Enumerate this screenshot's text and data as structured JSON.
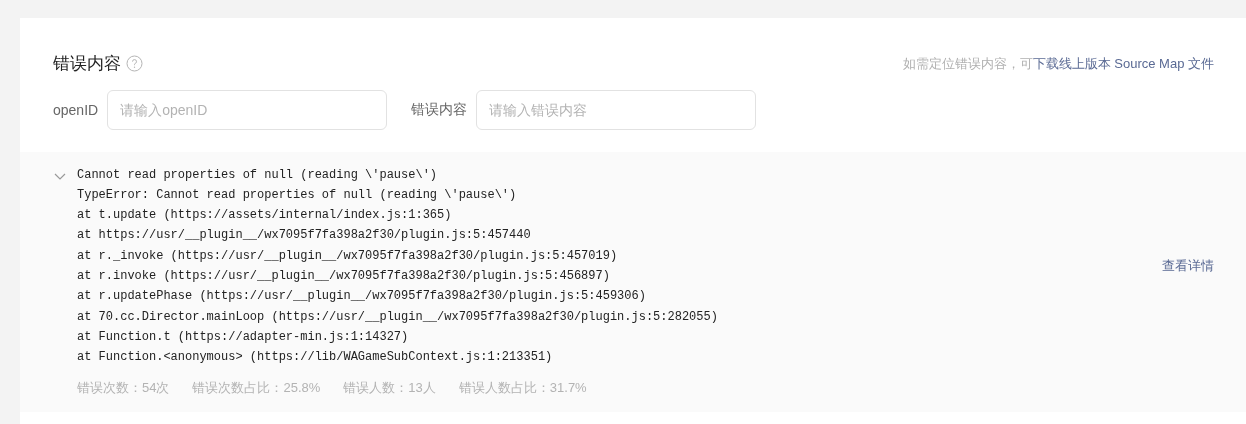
{
  "section": {
    "title": "错误内容",
    "hint_prefix": "如需定位错误内容，可",
    "hint_link": "下载线上版本 Source Map 文件"
  },
  "filters": [
    {
      "label": "openID",
      "placeholder": "请输入openID"
    },
    {
      "label": "错误内容",
      "placeholder": "请输入错误内容"
    }
  ],
  "errors": [
    {
      "expanded": true,
      "message": "Cannot read properties of null (reading \\'pause\\')",
      "stack": [
        "TypeError: Cannot read properties of null (reading \\'pause\\')",
        "at t.update (https://assets/internal/index.js:1:365)",
        "at https://usr/__plugin__/wx7095f7fa398a2f30/plugin.js:5:457440",
        "at r._invoke (https://usr/__plugin__/wx7095f7fa398a2f30/plugin.js:5:457019)",
        "at r.invoke (https://usr/__plugin__/wx7095f7fa398a2f30/plugin.js:5:456897)",
        "at r.updatePhase (https://usr/__plugin__/wx7095f7fa398a2f30/plugin.js:5:459306)",
        "at 70.cc.Director.mainLoop (https://usr/__plugin__/wx7095f7fa398a2f30/plugin.js:5:282055)",
        "at Function.t (https://adapter-min.js:1:14327)",
        "at Function.<anonymous> (https://lib/WAGameSubContext.js:1:213351)"
      ],
      "stats": [
        "错误次数：54次",
        "错误次数占比：25.8%",
        "错误人数：13人",
        "错误人数占比：31.7%"
      ],
      "detail_link": "查看详情"
    }
  ]
}
